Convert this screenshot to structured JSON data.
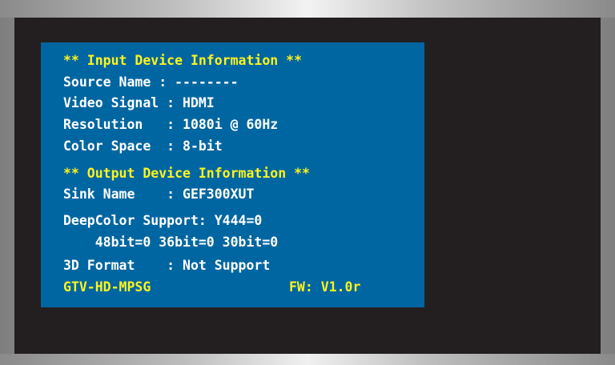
{
  "osd": {
    "input_header": "** Input Device Information **",
    "source_name": "Source Name : --------",
    "video_signal": "Video Signal : HDMI",
    "resolution": "Resolution   : 1080i @ 60Hz",
    "color_space": "Color Space  : 8-bit",
    "output_header": "** Output Device Information **",
    "sink_name": "Sink Name    : GEF300XUT",
    "deepcolor_support": "DeepColor Support: Y444=0",
    "deepcolor_bits": "    48bit=0 36bit=0 30bit=0",
    "format_3d": "3D Format    : Not Support",
    "model": "GTV-HD-MPSG",
    "firmware": "FW: V1.0r"
  },
  "colors": {
    "osd_background": "#0066a1",
    "header_text": "#fdf31f",
    "body_text": "#ffffff",
    "screen_background": "#231f20"
  }
}
